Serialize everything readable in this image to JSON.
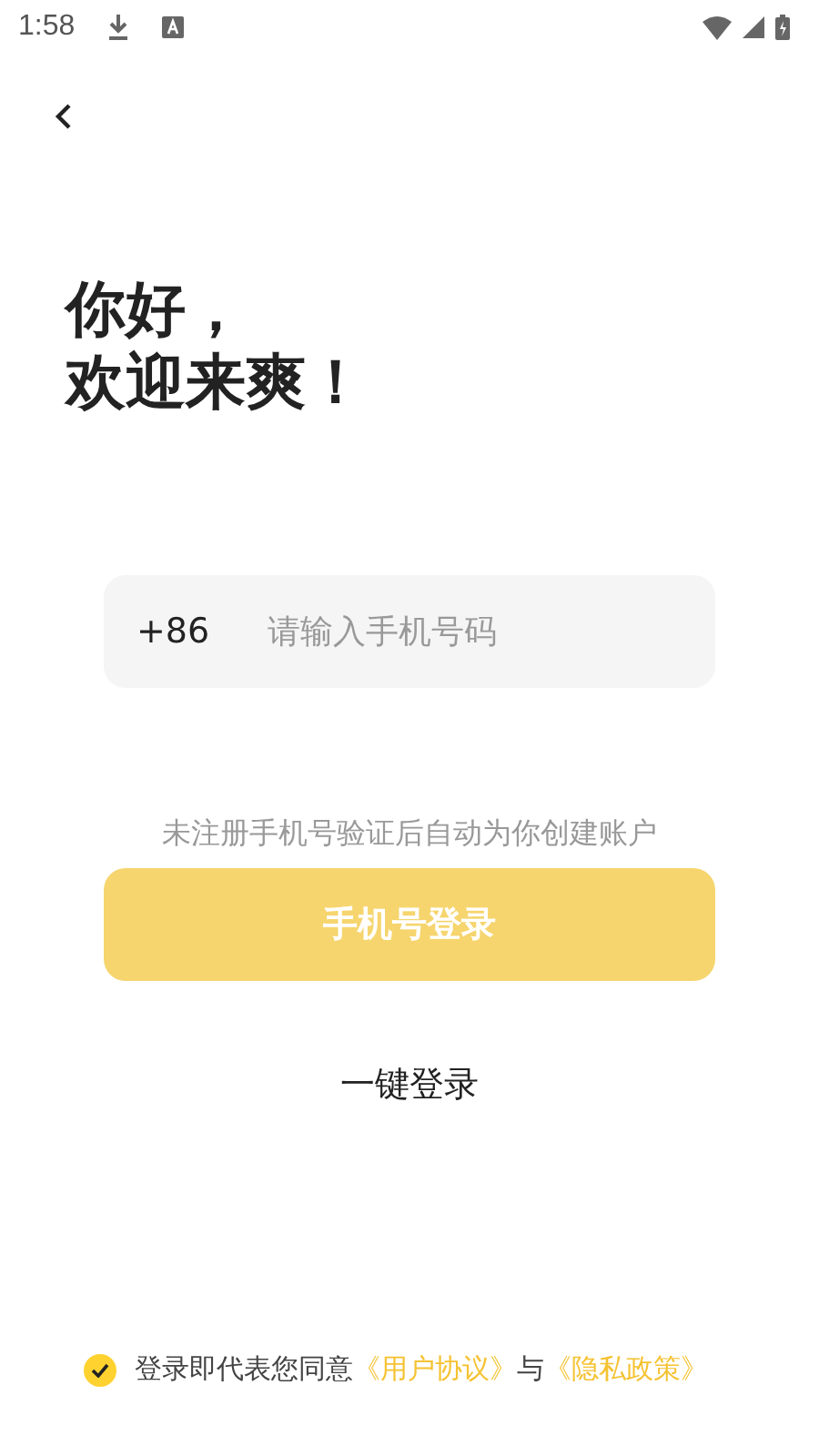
{
  "status_bar": {
    "time": "1:58"
  },
  "title": [
    "你好，",
    "欢迎来爽！"
  ],
  "phone_field": {
    "country_code": "+86",
    "placeholder": "请输入手机号码"
  },
  "hint": "未注册手机号验证后自动为你创建账户",
  "login_button": {
    "label": "手机号登录",
    "disabled": true
  },
  "one_tap_login": "一键登录",
  "agreement": {
    "checked": true,
    "text": "登录即代表您同意",
    "links": [
      {
        "kind": "link",
        "text": "《用户协议》"
      },
      {
        "kind": "plain",
        "text": "与"
      },
      {
        "kind": "link",
        "text": "《隐私政策》"
      }
    ]
  }
}
